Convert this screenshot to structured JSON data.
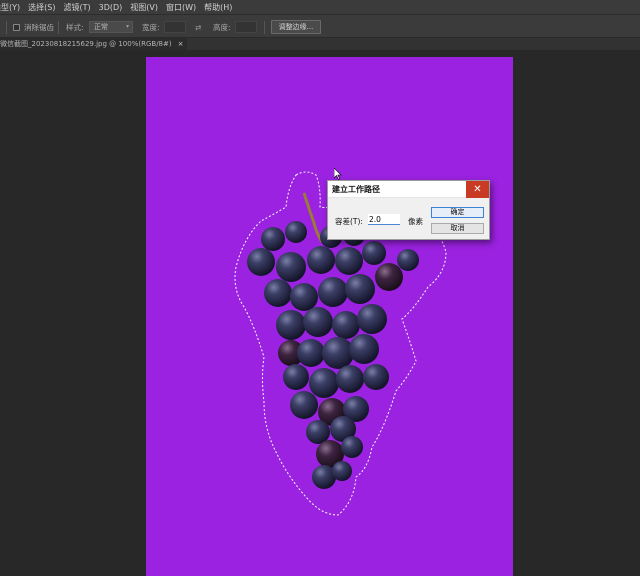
{
  "menubar": {
    "items": [
      "类型(Y)",
      "选择(S)",
      "滤镜(T)",
      "3D(D)",
      "视图(V)",
      "窗口(W)",
      "帮助(H)"
    ]
  },
  "options_bar": {
    "antialias_label": "消除锯齿",
    "style_label": "样式:",
    "style_value": "正常",
    "width_label": "宽度:",
    "height_label": "高度:",
    "refine_edge_label": "调整边缘..."
  },
  "document_tab": {
    "title": "微信截图_20230818215629.jpg @ 100%(RGB/8#)",
    "close_glyph": "×"
  },
  "canvas": {
    "background_color": "#9a22e0",
    "subject": "grape cluster with marching-ants selection"
  },
  "dialog": {
    "title": "建立工作路径",
    "close_glyph": "✕",
    "tolerance_label": "容差(T):",
    "tolerance_value": "2.0",
    "tolerance_unit": "像素",
    "ok_label": "确定",
    "cancel_label": "取消"
  },
  "colors": {
    "app_bg": "#282828",
    "panel_bg": "#3b3b3b",
    "canvas_purple": "#9a22e0",
    "dialog_close_red": "#c93a24",
    "focus_blue": "#3b83d4"
  }
}
